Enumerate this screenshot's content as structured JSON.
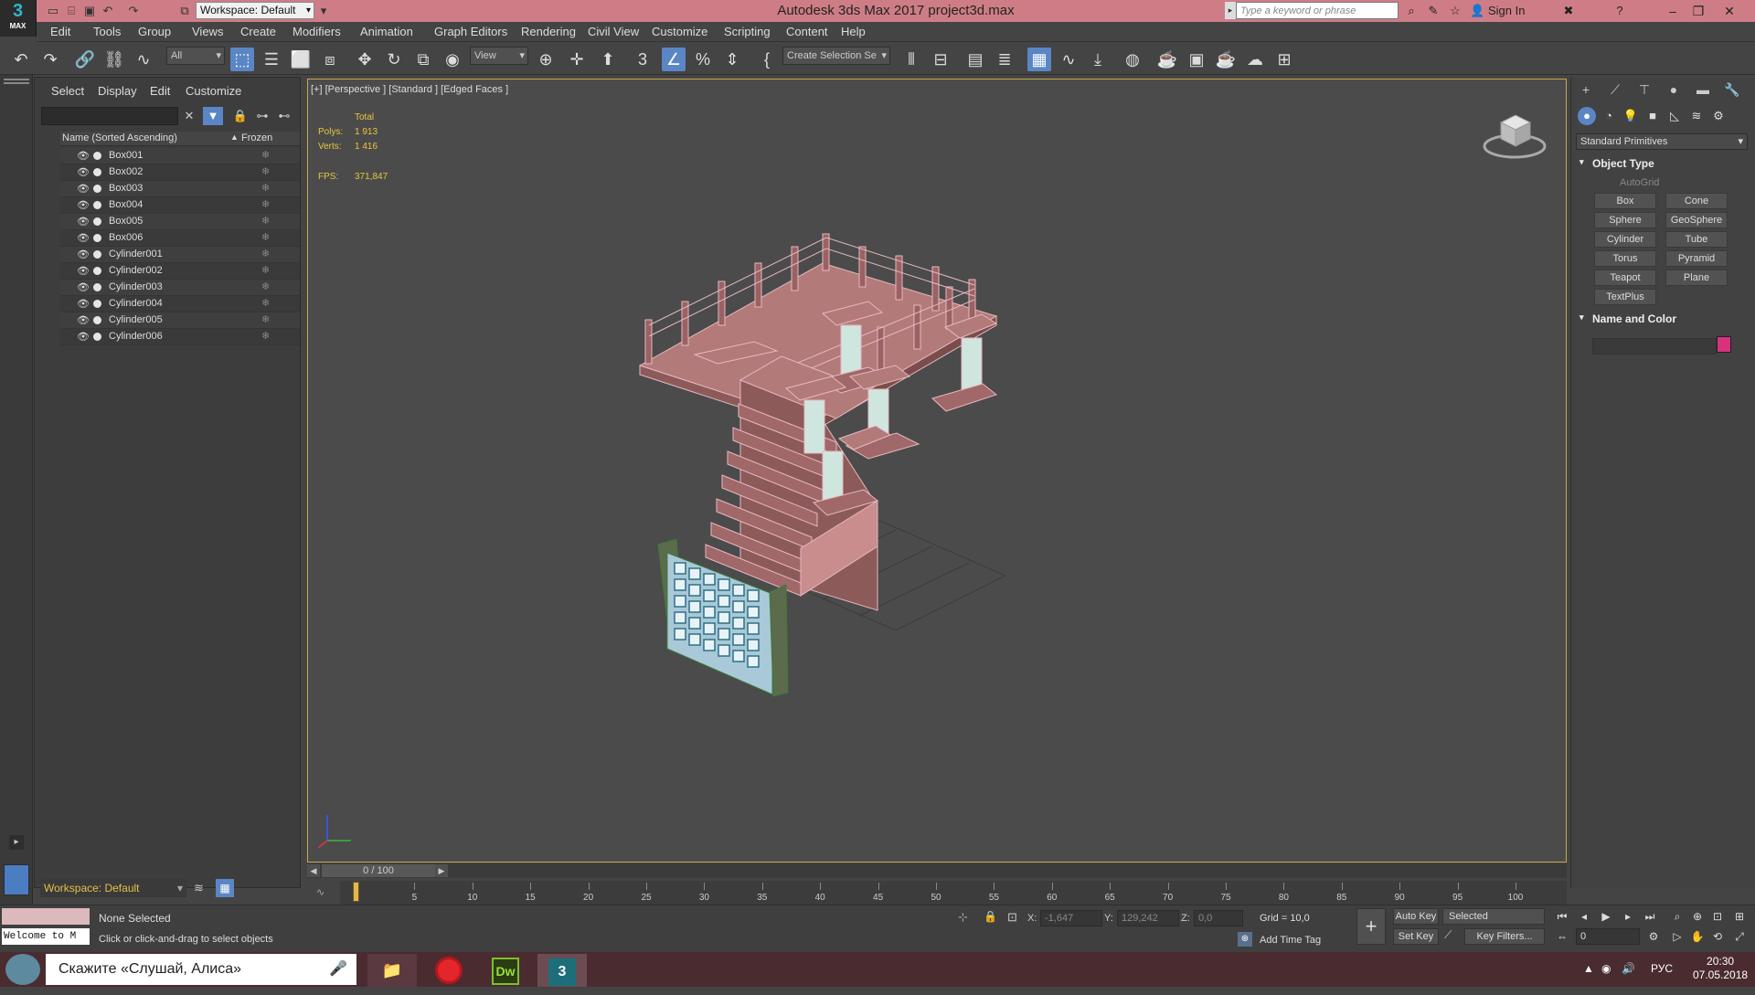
{
  "titlebar": {
    "app_logo": "3",
    "app_logo_sub": "MAX",
    "workspace": "Workspace: Default",
    "title": "Autodesk 3ds Max 2017     project3d.max",
    "search_placeholder": "Type a keyword or phrase",
    "sign_in": "Sign In"
  },
  "menu": [
    "Edit",
    "Tools",
    "Group",
    "Views",
    "Create",
    "Modifiers",
    "Animation",
    "Graph Editors",
    "Rendering",
    "Civil View",
    "Customize",
    "Scripting",
    "Content",
    "Help"
  ],
  "toolbar": {
    "selection_filter": "All",
    "ref_coord": "View",
    "named_selection": "Create Selection Se"
  },
  "explorer": {
    "menu": [
      "Select",
      "Display",
      "Edit",
      "Customize"
    ],
    "col_name": "Name (Sorted Ascending)",
    "col_sort_arrow": "▲",
    "col_frozen": "Frozen",
    "rows": [
      "Box001",
      "Box002",
      "Box003",
      "Box004",
      "Box005",
      "Box006",
      "Cylinder001",
      "Cylinder002",
      "Cylinder003",
      "Cylinder004",
      "Cylinder005",
      "Cylinder006"
    ],
    "workspace": "Workspace: Default"
  },
  "viewport": {
    "label": "[+] [Perspective ] [Standard ] [Edged Faces ]",
    "stats": {
      "total_label": "Total",
      "polys_label": "Polys:",
      "polys_value": "1 913",
      "verts_label": "Verts:",
      "verts_value": "1 416",
      "fps_label": "FPS:",
      "fps_value": "371,847"
    }
  },
  "timeslider": {
    "position": "0 / 100",
    "ticks": [
      5,
      10,
      15,
      20,
      25,
      30,
      35,
      40,
      45,
      50,
      55,
      60,
      65,
      70,
      75,
      80,
      85,
      90,
      95,
      100
    ]
  },
  "cmdpanel": {
    "category": "Standard Primitives",
    "object_type_title": "Object Type",
    "autogrid": "AutoGrid",
    "primitives": [
      "Box",
      "Cone",
      "Sphere",
      "GeoSphere",
      "Cylinder",
      "Tube",
      "Torus",
      "Pyramid",
      "Teapot",
      "Plane",
      "TextPlus"
    ],
    "name_color_title": "Name and Color",
    "object_color": "#d6337c"
  },
  "status": {
    "maxscript_text": "Welcome to M",
    "selection": "None Selected",
    "hint": "Click or click-and-drag to select objects",
    "x_label": "X:",
    "x_value": "-1,647",
    "y_label": "Y:",
    "y_value": "129,242",
    "z_label": "Z:",
    "z_value": "0,0",
    "grid": "Grid = 10,0",
    "add_time_tag": "Add Time Tag",
    "auto_key": "Auto Key",
    "set_key": "Set Key",
    "selected_dropdown": "Selected",
    "key_filters": "Key Filters...",
    "frame": "0"
  },
  "taskbar": {
    "alice": "Скажите «Слушай, Алиса»",
    "dw": "Dw",
    "max": "3",
    "lang": "РУС",
    "time": "20:30",
    "date": "07.05.2018"
  }
}
